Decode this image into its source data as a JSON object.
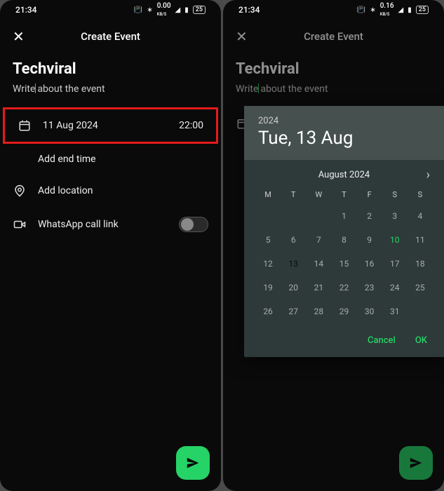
{
  "statusBar": {
    "time": "21:34",
    "kbps": "0.00",
    "kbps2": "0.16",
    "kbpsLabel": "KB/S",
    "battery": "25"
  },
  "header": {
    "title": "Create Event"
  },
  "event": {
    "title": "Techviral",
    "descPlaceholder": "Write about the event"
  },
  "rows": {
    "date": "11 Aug 2024",
    "time": "22:00",
    "addEnd": "Add end time",
    "addLocation": "Add location",
    "whatsappCall": "WhatsApp call link"
  },
  "picker": {
    "year": "2024",
    "dateLabel": "Tue, 13 Aug",
    "monthLabel": "August 2024",
    "dow": [
      "M",
      "T",
      "W",
      "T",
      "F",
      "S",
      "S"
    ],
    "weeks": [
      [
        "",
        "",
        "",
        "1",
        "2",
        "3",
        "4"
      ],
      [
        "5",
        "6",
        "7",
        "8",
        "9",
        "10",
        "11"
      ],
      [
        "12",
        "13",
        "14",
        "15",
        "16",
        "17",
        "18"
      ],
      [
        "19",
        "20",
        "21",
        "22",
        "23",
        "24",
        "25"
      ],
      [
        "26",
        "27",
        "28",
        "29",
        "30",
        "31",
        ""
      ]
    ],
    "selected": "13",
    "accent": "10",
    "cancel": "Cancel",
    "ok": "OK"
  }
}
